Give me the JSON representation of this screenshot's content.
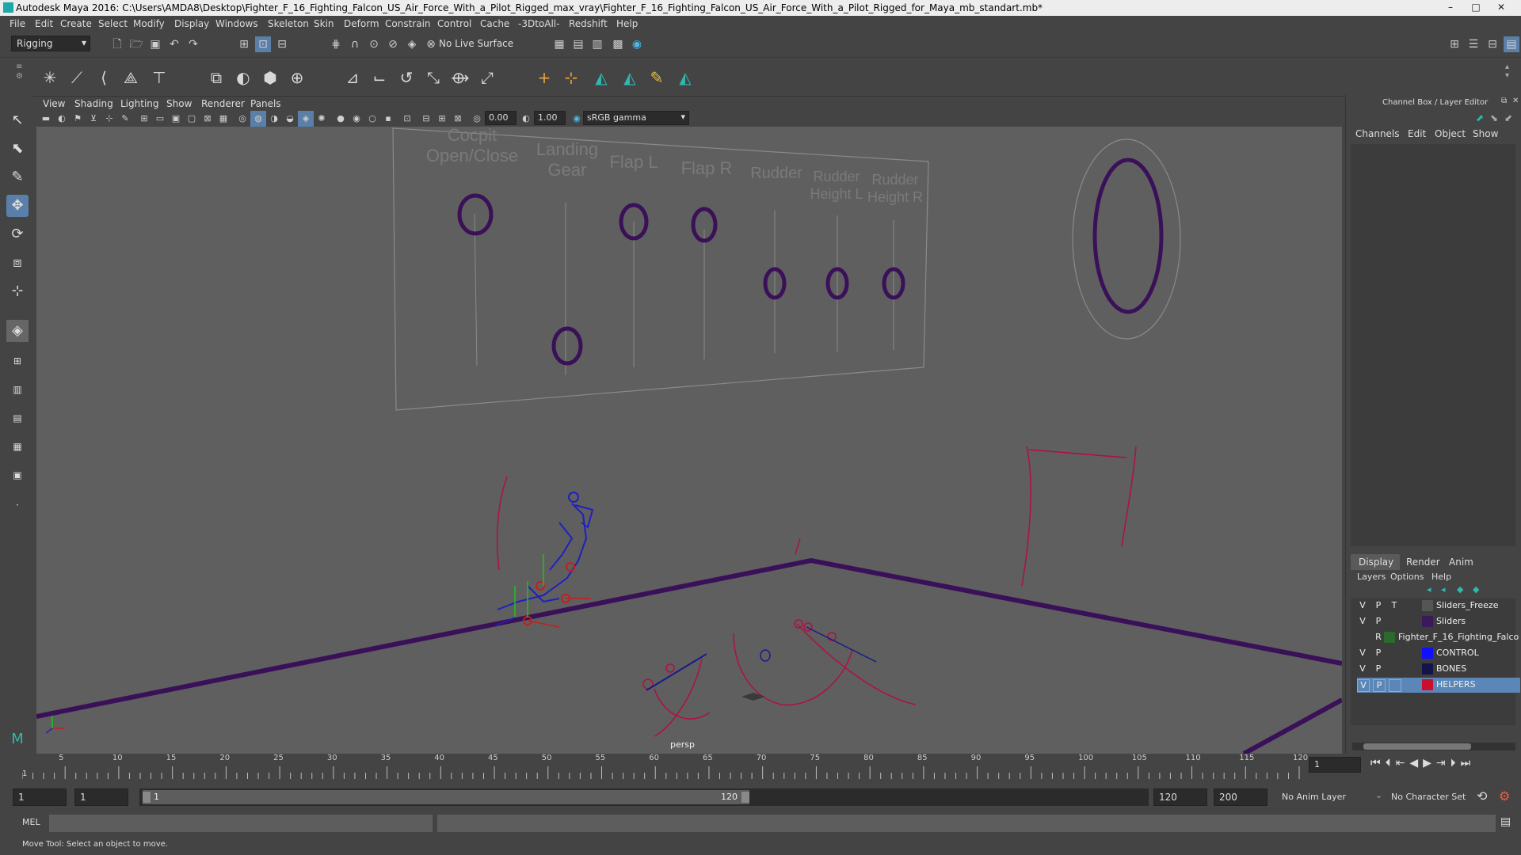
{
  "window": {
    "title": "Autodesk Maya 2016: C:\\Users\\AMDA8\\Desktop\\Fighter_F_16_Fighting_Falcon_US_Air_Force_With_a_Pilot_Rigged_max_vray\\Fighter_F_16_Fighting_Falcon_US_Air_Force_With_a_Pilot_Rigged_for_Maya_mb_standart.mb*",
    "minimize": "–",
    "maximize": "□",
    "close": "✕"
  },
  "menubar": [
    "File",
    "Edit",
    "Create",
    "Select",
    "Modify",
    "Display",
    "Windows",
    "Skeleton",
    "Skin",
    "Deform",
    "Constrain",
    "Control",
    "Cache",
    "-3DtoAll-",
    "Redshift",
    "Help"
  ],
  "statusline": {
    "mode": "Rigging",
    "live_surface": "No Live Surface"
  },
  "viewport": {
    "menus": [
      "View",
      "Shading",
      "Lighting",
      "Show",
      "Renderer",
      "Panels"
    ],
    "exposure": "0.00",
    "gamma": "1.00",
    "color_space": "sRGB gamma",
    "camera_label": "persp",
    "control_labels": [
      "Cocpit\nOpen/Close",
      "Landing\nGear",
      "Flap L",
      "Flap R",
      "Rudder",
      "Rudder\nHeight L",
      "Rudder\nHeight R"
    ]
  },
  "channel_box": {
    "title": "Channel Box / Layer Editor",
    "menus": [
      "Channels",
      "Edit",
      "Object",
      "Show"
    ],
    "layer_tabs": [
      "Display",
      "Render",
      "Anim"
    ],
    "layer_menus": [
      "Layers",
      "Options",
      "Help"
    ],
    "layers": [
      {
        "v": "V",
        "p": "P",
        "t": "T",
        "name": "Sliders_Freeze",
        "color": "#444444"
      },
      {
        "v": "V",
        "p": "P",
        "t": "",
        "name": "Sliders",
        "color": "#3a1a5a"
      },
      {
        "v": "",
        "p": "R",
        "t": "",
        "name": "Fighter_F_16_Fighting_Falco",
        "color": "#2a6a2a"
      },
      {
        "v": "V",
        "p": "P",
        "t": "",
        "name": "CONTROL",
        "color": "#1010ff"
      },
      {
        "v": "V",
        "p": "P",
        "t": "",
        "name": "BONES",
        "color": "#14144a"
      },
      {
        "v": "V",
        "p": "P",
        "t": "",
        "name": "HELPERS",
        "color": "#c8102e"
      }
    ]
  },
  "timeline": {
    "ticks": [
      "5",
      "10",
      "15",
      "20",
      "25",
      "30",
      "35",
      "40",
      "45",
      "50",
      "55",
      "60",
      "65",
      "70",
      "75",
      "80",
      "85",
      "90",
      "95",
      "100",
      "105",
      "110",
      "115",
      "120"
    ],
    "start_tick": "1",
    "current_frame": "1",
    "range_start": "1",
    "range_start_inner": "1",
    "range_slider_start": "1",
    "range_slider_end": "120",
    "range_end": "120",
    "anim_end": "200",
    "anim_layer": "No Anim Layer",
    "character_set": "No Character Set"
  },
  "command_line": {
    "label": "MEL"
  },
  "help_line": {
    "text": "Move Tool: Select an object to move."
  }
}
